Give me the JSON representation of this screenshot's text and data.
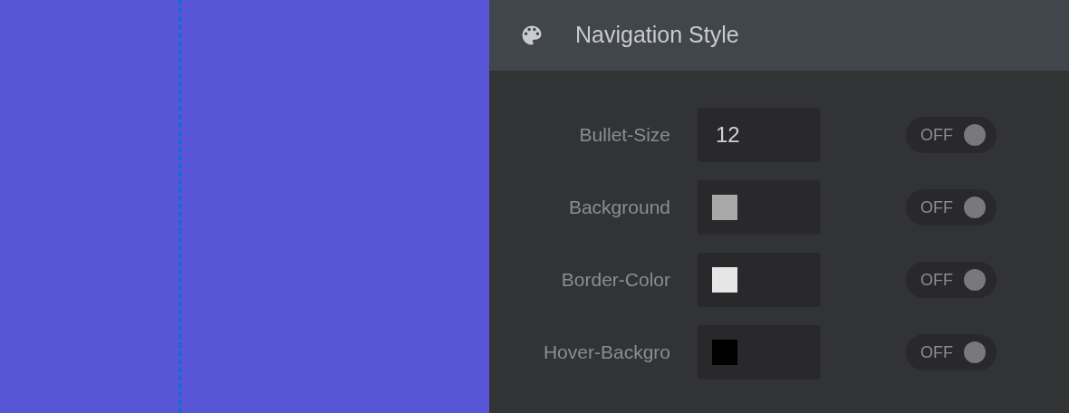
{
  "panel": {
    "title": "Navigation Style",
    "settings": [
      {
        "label": "Bullet-Size",
        "kind": "number",
        "value": "12",
        "toggle": {
          "label": "OFF",
          "on": false
        }
      },
      {
        "label": "Background",
        "kind": "color",
        "color": "#a8a8a8",
        "toggle": {
          "label": "OFF",
          "on": false
        }
      },
      {
        "label": "Border-Color",
        "kind": "color",
        "color": "#e6e6e6",
        "toggle": {
          "label": "OFF",
          "on": false
        }
      },
      {
        "label": "Hover-Backgro",
        "kind": "color",
        "color": "#000000",
        "toggle": {
          "label": "OFF",
          "on": false
        }
      }
    ]
  }
}
